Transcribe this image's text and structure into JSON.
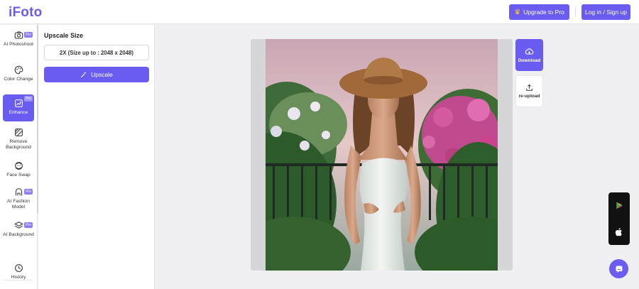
{
  "app": {
    "logo": "iFoto"
  },
  "header": {
    "upgrade_label": "Upgrade to Pro",
    "login_label": "Log in / Sign up"
  },
  "sidebar": {
    "items": [
      {
        "label": "AI Photoshoot",
        "icon": "camera-icon",
        "pro": "Pro"
      },
      {
        "label": "Color Change",
        "icon": "palette-icon",
        "pro": ""
      },
      {
        "label": "Enhance",
        "icon": "enhance-icon",
        "pro": "Pro",
        "active": true
      },
      {
        "label": "Remove Background",
        "icon": "remove-bg-icon",
        "pro": ""
      },
      {
        "label": "Face Swap",
        "icon": "face-swap-icon",
        "pro": ""
      },
      {
        "label": "AI Fashion Model",
        "icon": "fashion-model-icon",
        "pro": "Pro"
      },
      {
        "label": "AI Background",
        "icon": "layers-icon",
        "pro": "Pro"
      },
      {
        "label": "History",
        "icon": "clock-icon",
        "pro": ""
      }
    ]
  },
  "panel": {
    "title": "Upscale Size",
    "size_option": "2X (Size up to : 2048 x 2048)",
    "upscale_label": "Upscale"
  },
  "actions": {
    "download_label": "Download",
    "reupload_label": "re-upload"
  },
  "colors": {
    "accent": "#6a5cf0"
  }
}
